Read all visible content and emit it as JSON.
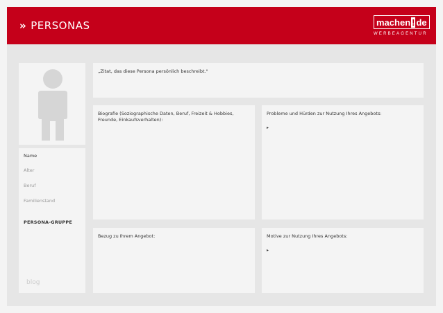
{
  "header": {
    "title": "PERSONAS",
    "chevron": "»",
    "logo": {
      "word": "machen",
      "mark": "!",
      "suffix": "de",
      "tagline": "WERBEAGENTUR"
    }
  },
  "quote": "„Zitat, das diese Persona persönlich beschreibt.\"",
  "bio": "Biografie (Soziographische Daten, Beruf, Freizeit & Hobbies, Freunde, Einkaufsverhalten):",
  "problems": {
    "label": "Probleme und Hürden zur Nutzung Ihres Angebots:",
    "bullet": "▸"
  },
  "relation": {
    "label": "Bezug zu Ihrem Angebot:"
  },
  "motives": {
    "label": "Motive zur Nutzung Ihres Angebots:",
    "bullet": "▸"
  },
  "profile": {
    "name": "Name",
    "age": "Alter",
    "job": "Beruf",
    "family": "Familienstand",
    "group": "PERSONA-GRUPPE",
    "blog": "blog"
  },
  "colors": {
    "brand": "#c5001a",
    "panel": "#f4f4f4",
    "frame": "#e6e6e6",
    "avatar": "#d6d6d6"
  },
  "icons": {
    "avatar": "person-silhouette-icon"
  }
}
